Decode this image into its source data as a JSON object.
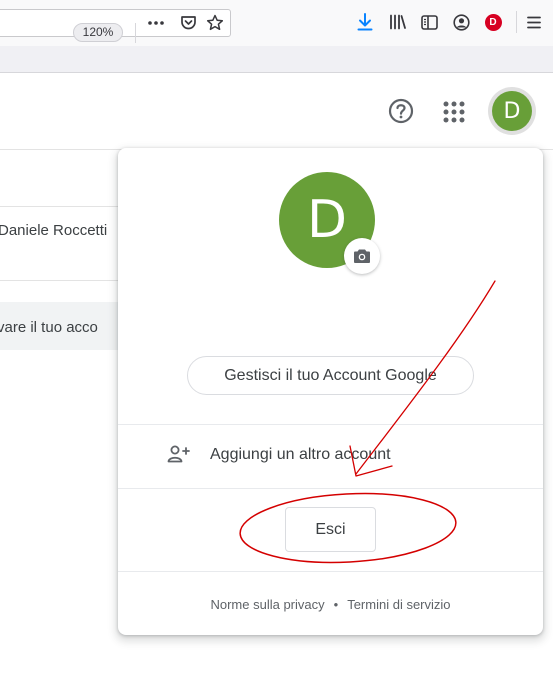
{
  "browser": {
    "zoom_level": "120%",
    "icons": [
      "more-dots-icon",
      "pocket-icon",
      "bookmark-star-icon",
      "download-icon",
      "library-icon",
      "sidebar-icon",
      "account-icon",
      "extension-icon",
      "hamburger-menu-icon"
    ],
    "extension_badge": "D",
    "colors": {
      "download_accent": "#0a84ff",
      "extension": "#d70022"
    }
  },
  "app_header": {
    "help_icon": "help-circle-icon",
    "apps_icon": "apps-grid-icon",
    "avatar_letter": "D",
    "avatar_color": "#689f38"
  },
  "background": {
    "user_name": "Daniele Roccetti",
    "banner_text": "vare il tuo acco"
  },
  "account_menu": {
    "avatar_letter": "D",
    "avatar_color": "#689f38",
    "camera_icon": "camera-icon",
    "manage_label": "Gestisci il tuo Account Google",
    "add_account_icon": "person-add-icon",
    "add_account_label": "Aggiungi un altro account",
    "sign_out_label": "Esci",
    "privacy_label": "Norme sulla privacy",
    "separator": "•",
    "terms_label": "Termini di servizio"
  },
  "annotation": {
    "color": "#d40000",
    "shapes": [
      "arrow",
      "ellipse"
    ]
  }
}
